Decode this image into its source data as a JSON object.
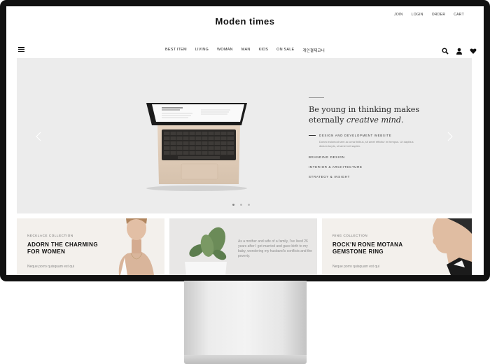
{
  "header": {
    "brand": "Moden times",
    "top_links": [
      "JOIN",
      "LOGIN",
      "ORDER",
      "CART"
    ]
  },
  "nav": {
    "items": [
      "BEST ITEM",
      "LIVING",
      "WOMAN",
      "MAN",
      "KIDS",
      "ON SALE",
      "개인결제코너"
    ]
  },
  "icons": {
    "menu": "hamburger-menu-icon",
    "search": "search-icon",
    "user": "user-icon",
    "wishlist": "heart-icon",
    "prev": "chevron-left-icon",
    "next": "chevron-right-icon"
  },
  "hero": {
    "title_line1": "Be young in thinking makes",
    "title_line2_plain": "eternally ",
    "title_line2_italic": "creative mind.",
    "active_item": "DESIGN AND DEVELOPMENT WEBSITE",
    "active_desc": "Donec euismod sem ac urna finibus, sit amet efficitur mi tempus. Ut dapibus dictum turpis, sit amet vel sapien.",
    "items": [
      "BRANDING DESIGN",
      "INTERIOR & ARCHITECTURE",
      "STRATEGY & INSIGHT"
    ],
    "slide_count": 3,
    "active_slide": 1
  },
  "cards": [
    {
      "tag": "NECKLACE COLLECTION",
      "title_line1": "ADORN THE CHARMING",
      "title_line2": "FOR WOMEN",
      "sub": "Neque porro quisquam est qui"
    },
    {
      "quote": "As a mother and wife of a family, I've lived 26 years after I got married and gave birth to my baby, wondering my husband's conflicts and the poverty."
    },
    {
      "tag": "RING COLLECTION",
      "title_line1": "ROCK'N RONE MOTANA",
      "title_line2": "GEMSTONE RING",
      "sub": "Neque porro quisquam est qui"
    }
  ],
  "colors": {
    "bezel": "#111111",
    "hero_bg": "#ececec",
    "card_bg": "#f3f0ec"
  }
}
